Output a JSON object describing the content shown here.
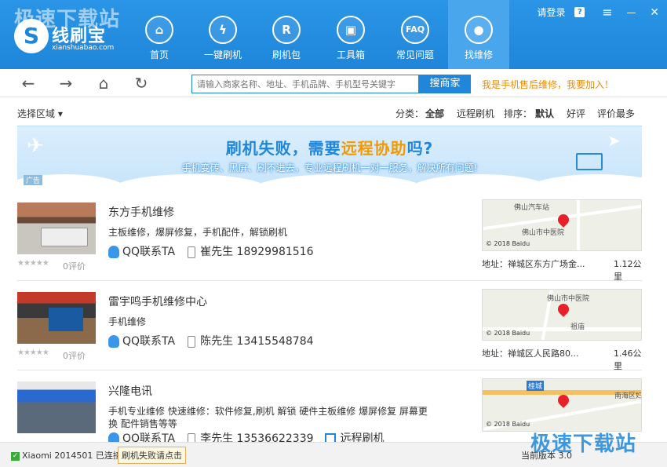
{
  "app": {
    "watermark": "极速下载站",
    "logo_text": "线刷宝",
    "logo_site": "xianshuabao.com"
  },
  "nav": [
    {
      "label": "首页",
      "icon": "home-icon",
      "glyph": "⌂"
    },
    {
      "label": "一键刷机",
      "icon": "flash-icon",
      "glyph": "ϟ"
    },
    {
      "label": "刷机包",
      "icon": "cloud-package-icon",
      "glyph": "R"
    },
    {
      "label": "工具箱",
      "icon": "toolbox-icon",
      "glyph": "▣"
    },
    {
      "label": "常见问题",
      "icon": "faq-icon",
      "glyph": "FAQ"
    },
    {
      "label": "找维修",
      "icon": "repair-person-icon",
      "glyph": "●"
    }
  ],
  "window": {
    "login": "请登录",
    "help": "?",
    "menu": "≡",
    "minimize": "—",
    "close": "✕"
  },
  "toolbar": {
    "back": "←",
    "forward": "→",
    "home": "⌂",
    "refresh": "↻",
    "search_placeholder": "请输入商家名称、地址、手机品牌、手机型号关键字",
    "search_button": "搜商家",
    "join_link": "我是手机售后维修，我要加入！"
  },
  "filters": {
    "region": "选择区域 ▾",
    "category_label": "分类：",
    "category_all": "全部",
    "category_remote": "远程刷机",
    "sort_label": "排序：",
    "sort_default": "默认",
    "sort_good": "好评",
    "sort_most": "评价最多"
  },
  "banner": {
    "title_pre": "刷机失败，需要",
    "title_hl": "远程协助",
    "title_post": "吗?",
    "subtitle": "手机变砖、黑屏、刷不进去，专业远程刷机一对一服务，解决所有问题!",
    "ad": "广告"
  },
  "shops": [
    {
      "name": "东方手机维修",
      "desc": "主板维修，爆屏修复，手机配件，解锁刷机",
      "qq": "QQ联系TA",
      "contact_name": "崔先生",
      "phone": "18929981516",
      "stars": "★★★★★",
      "reviews": "0评价",
      "map_labels": [
        "佛山汽车站",
        "佛山市中医院"
      ],
      "map_copy": "© 2018 Baidu",
      "address": "地址：禅城区东方广场金...",
      "distance": "1.12公里",
      "remote": ""
    },
    {
      "name": "雷宇鸣手机维修中心",
      "desc": "手机维修",
      "qq": "QQ联系TA",
      "contact_name": "陈先生",
      "phone": "13415548784",
      "stars": "★★★★★",
      "reviews": "0评价",
      "map_labels": [
        "佛山市中医院",
        "祖庙"
      ],
      "map_copy": "© 2018 Baidu",
      "address": "地址：禅城区人民路80...",
      "distance": "1.46公里",
      "remote": ""
    },
    {
      "name": "兴隆电讯",
      "desc": "手机专业维修 快速维修：软件修复,刷机 解锁 硬件主板维修 爆屏修复 屏幕更换 配件销售等等",
      "qq": "QQ联系TA",
      "contact_name": "李先生",
      "phone": "13536622339",
      "stars": "",
      "reviews": "",
      "map_labels": [
        "桂城",
        "南海区妇保健院"
      ],
      "map_copy": "© 2018 Baidu",
      "address": "",
      "distance": "",
      "remote": "远程刷机"
    }
  ],
  "status": {
    "connected": "Xiaomi 2014501 已连接",
    "fail_button": "刷机失败请点击",
    "page_info": "当前版本 3.0"
  }
}
